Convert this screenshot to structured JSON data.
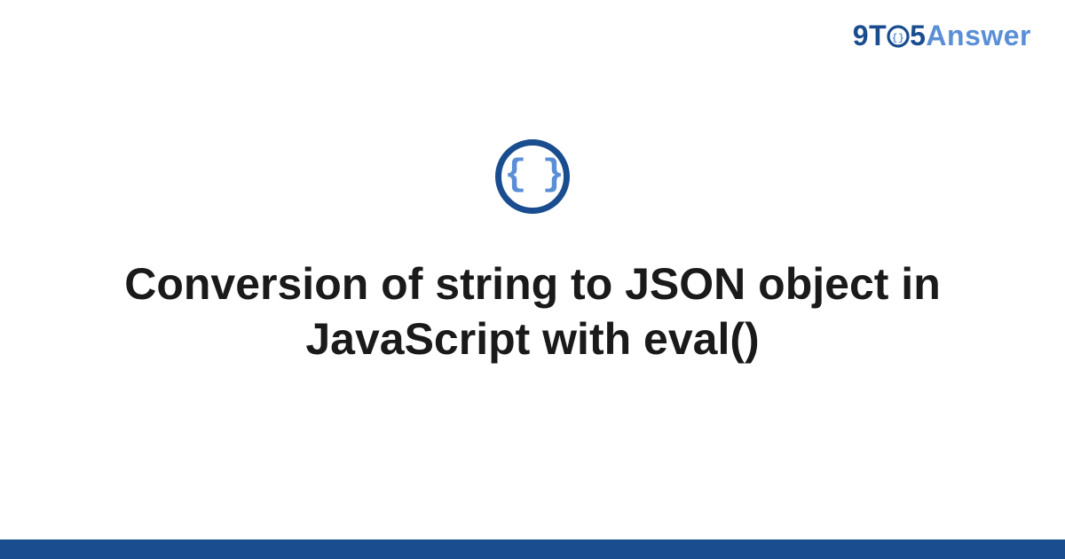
{
  "brand": {
    "nine": "9",
    "t": "T",
    "o_icon": "braces",
    "five": "5",
    "answer": "Answer"
  },
  "icon": {
    "name": "json-braces-icon",
    "glyph": "{ }"
  },
  "title": "Conversion of string to JSON object in JavaScript with eval()",
  "colors": {
    "primary": "#1a4d8f",
    "secondary": "#5a8fd6",
    "text": "#1a1a1a"
  }
}
